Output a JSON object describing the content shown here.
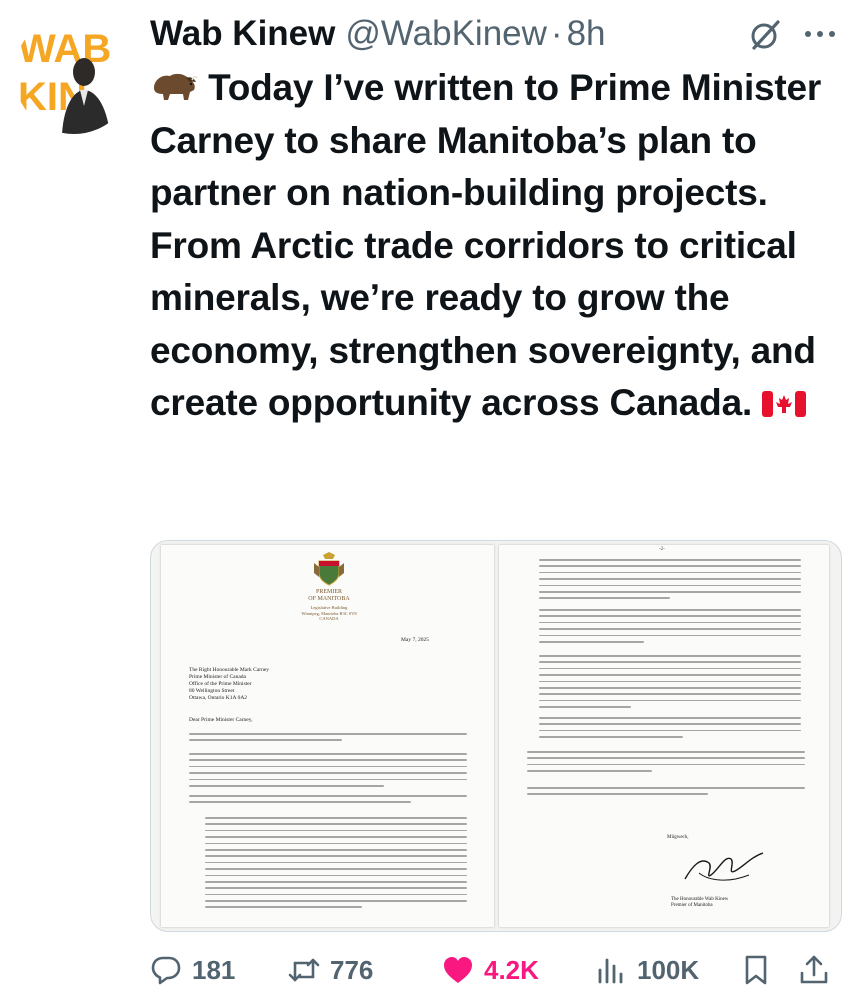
{
  "author": {
    "name": "Wab Kinew",
    "handle": "@WabKinew",
    "separator": "·",
    "time": "8h",
    "avatar_text": "WAB KINEW"
  },
  "tweet": {
    "emoji": "bison",
    "text": "Today I’ve written to Prime Minister Carney to share Manitoba’s plan to partner on nation-building projects. From Arctic trade corridors to critical minerals, we’re ready to grow the economy, strengthen sovereignty, and create opportunity across Canada.",
    "flag": "canada-flag"
  },
  "letter": {
    "page1": {
      "premier_title": "PREMIER\nOF MANITOBA",
      "address": "Legislative Building\nWinnipeg, Manitoba R3C 0V8\nCANADA",
      "date": "May 7, 2025",
      "recipient": "The Right Honourable Mark Carney\nPrime Minister of Canada\nOffice of the Prime Minister\n80 Wellington Street\nOttawa, Ontario  K1A 0A2",
      "salutation": "Dear Prime Minister Carney,"
    },
    "page2": {
      "page_number": "-2-",
      "closing": "Miigwech,",
      "signer": "The Honourable Wab Kinew\nPremier of Manitoba"
    }
  },
  "actions": {
    "replies": "181",
    "reposts": "776",
    "likes": "4.2K",
    "views": "100K"
  },
  "colors": {
    "text": "#0f1419",
    "secondary": "#536471",
    "like": "#f91880",
    "avatar_accent": "#f5a623"
  }
}
